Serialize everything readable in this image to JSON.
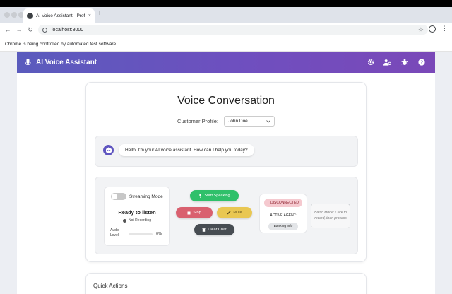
{
  "browser": {
    "tab_title": "AI Voice Assistant - Professio",
    "tab_close": "×",
    "new_tab": "+",
    "url": "localhost:8000",
    "infobar_text": "Chrome is being controlled by automated test software."
  },
  "header": {
    "title": "AI Voice Assistant",
    "icons": [
      "microphone-icon",
      "settings-icon",
      "user-cog-icon",
      "bug-icon",
      "help-icon"
    ],
    "gradient": [
      "#5a5bbd",
      "#7a48b8"
    ]
  },
  "main": {
    "title": "Voice Conversation",
    "profile_label": "Customer Profile:",
    "profile_value": "John Doe",
    "chat": {
      "messages": [
        {
          "sender": "bot",
          "text": "Hello! I'm your AI voice assistant. How can I help you today?"
        }
      ]
    },
    "status": {
      "streaming_label": "Streaming Mode",
      "streaming_on": false,
      "ready_text": "Ready to listen",
      "recording_text": "Not Recording",
      "audio_label": "Audio Level:",
      "audio_level_percent": 0,
      "audio_value": "0%"
    },
    "buttons": {
      "start": "Start Speaking",
      "stop": "Stop",
      "mute": "Mute",
      "clear": "Clear Chat"
    },
    "agent": {
      "connection": "DISCONNECTED",
      "active_label": "ACTIVE AGENT:",
      "active_value": "Banking Info"
    },
    "batch_hint": "Batch Mode: Click to record, then process"
  },
  "quick_actions": {
    "title": "Quick Actions"
  },
  "colors": {
    "start": "#2fc06a",
    "stop": "#d9606f",
    "mute": "#e9c752",
    "clear": "#474c52",
    "disconnected": "#f5c9cf"
  }
}
